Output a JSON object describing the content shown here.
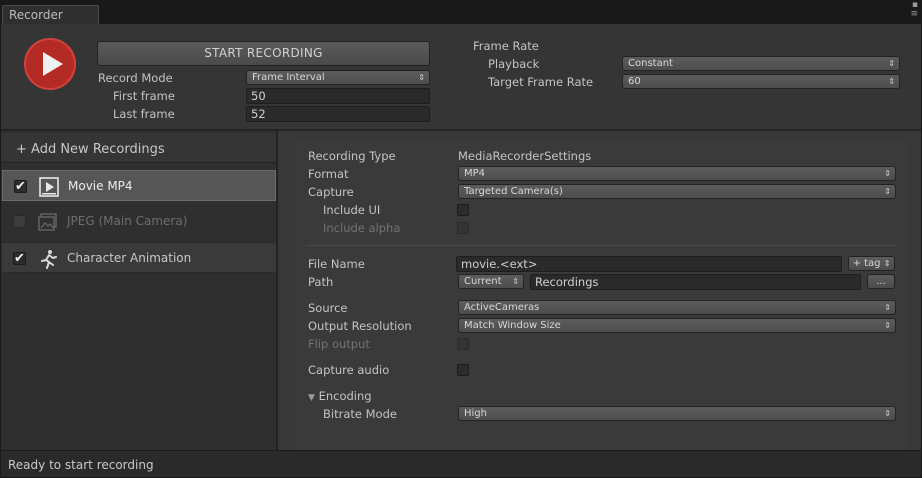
{
  "window": {
    "tab_title": "Recorder",
    "menu_icon": "menu-icon"
  },
  "header": {
    "start_button": "START RECORDING",
    "record_mode_label": "Record Mode",
    "record_mode_value": "Frame Interval",
    "first_frame_label": "First frame",
    "first_frame_value": "50",
    "last_frame_label": "Last frame",
    "last_frame_value": "52",
    "frame_rate_label": "Frame Rate",
    "playback_label": "Playback",
    "playback_value": "Constant",
    "target_rate_label": "Target Frame Rate",
    "target_rate_value": "60",
    "dropdown_arrow": "⇕"
  },
  "recordings": {
    "add_new_label": "+ Add New Recordings",
    "items": [
      {
        "name": "Movie MP4",
        "checked": "✔",
        "icon": "movie-icon",
        "selected": true
      },
      {
        "name": "JPEG (Main Camera)",
        "checked": "",
        "icon": "image-icon",
        "selected": false
      },
      {
        "name": "Character Animation",
        "checked": "✔",
        "icon": "running-man-icon",
        "selected": false
      }
    ]
  },
  "settings": {
    "recording_type_label": "Recording Type",
    "recording_type_value": "MediaRecorderSettings",
    "format_label": "Format",
    "format_value": "MP4",
    "capture_label": "Capture",
    "capture_value": "Targeted Camera(s)",
    "include_ui_label": "Include UI",
    "include_alpha_label": "Include alpha",
    "file_name_label": "File Name",
    "file_name_value": "movie.<ext>",
    "tag_button": "+ tag",
    "path_label": "Path",
    "path_mode_value": "Current",
    "path_value": "Recordings",
    "browse_button": "...",
    "source_label": "Source",
    "source_value": "ActiveCameras",
    "output_resolution_label": "Output Resolution",
    "output_resolution_value": "Match Window Size",
    "flip_output_label": "Flip output",
    "capture_audio_label": "Capture audio",
    "encoding_label": "Encoding",
    "bitrate_mode_label": "Bitrate Mode",
    "bitrate_mode_value": "High"
  },
  "status": {
    "text": "Ready to start recording"
  },
  "colors": {
    "record_red": "#b42a24",
    "panel_bg": "#383838",
    "selected_item": "#565656"
  }
}
